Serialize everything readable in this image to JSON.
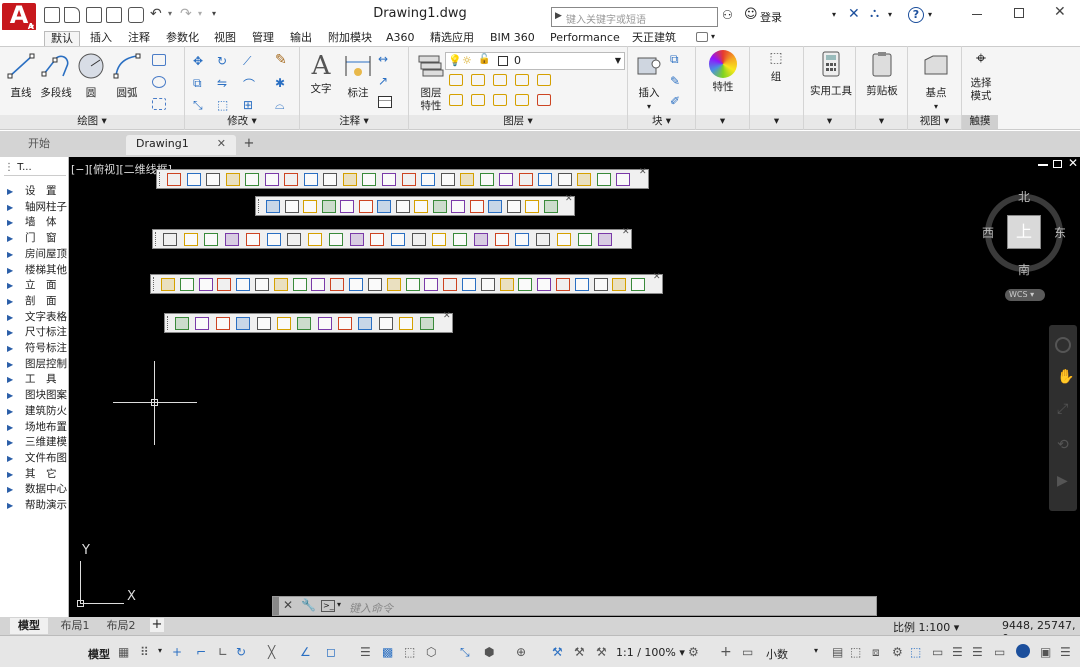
{
  "app": {
    "logo_letter": "A",
    "document_title": "Drawing1.dwg",
    "search_placeholder": "键入关键字或短语",
    "login_label": "登录",
    "help_icon": "?"
  },
  "ribbon_tabs": [
    "默认",
    "插入",
    "注释",
    "参数化",
    "视图",
    "管理",
    "输出",
    "附加模块",
    "A360",
    "精选应用",
    "BIM 360",
    "Performance",
    "天正建筑"
  ],
  "ribbon": {
    "draw": {
      "title": "绘图",
      "buttons": [
        "直线",
        "多段线",
        "圆",
        "圆弧"
      ]
    },
    "modify": {
      "title": "修改"
    },
    "annotate": {
      "title": "注释",
      "buttons": [
        "文字",
        "标注"
      ]
    },
    "layers": {
      "title": "图层",
      "buttons": [
        "图层\n特性"
      ],
      "current_layer": "0"
    },
    "block": {
      "title": "块",
      "buttons": [
        "插入"
      ]
    },
    "properties": {
      "title": "特性"
    },
    "groups": {
      "title": "组"
    },
    "utilities": {
      "title": "实用工具"
    },
    "clipboard": {
      "title": "剪贴板"
    },
    "view": {
      "title": "视图",
      "buttons": [
        "基点"
      ]
    },
    "touch": {
      "title": "触摸",
      "buttons": [
        "选择\n模式"
      ]
    }
  },
  "doc_tabs": [
    "开始",
    "Drawing1"
  ],
  "palette": {
    "title": "T...",
    "items": [
      "设　置",
      "轴网柱子",
      "墙　体",
      "门　窗",
      "房间屋顶",
      "楼梯其他",
      "立　面",
      "剖　面",
      "文字表格",
      "尺寸标注",
      "符号标注",
      "图层控制",
      "工　具",
      "图块图案",
      "建筑防火",
      "场地布置",
      "三维建模",
      "文件布图",
      "其　它",
      "数据中心",
      "帮助演示"
    ]
  },
  "viewport": {
    "label": "[−][俯视][二维线框]",
    "compass": {
      "north": "北",
      "south": "南",
      "east": "东",
      "west": "西",
      "center": "上"
    },
    "wcs": "WCS",
    "ucs_x": "X",
    "ucs_y": "Y"
  },
  "command_line": {
    "placeholder": "键入命令"
  },
  "layout_tabs": [
    "模型",
    "布局1",
    "布局2"
  ],
  "status": {
    "scale": "比例 1:100",
    "coords": "9448, 25747, 0",
    "model_label": "模型",
    "annotation_scale": "1:1 / 100%",
    "size_label": "小数"
  },
  "colors": {
    "accent": "#c7181d",
    "canvas": "#000000",
    "ribbon_bg": "#f5f5f5"
  }
}
